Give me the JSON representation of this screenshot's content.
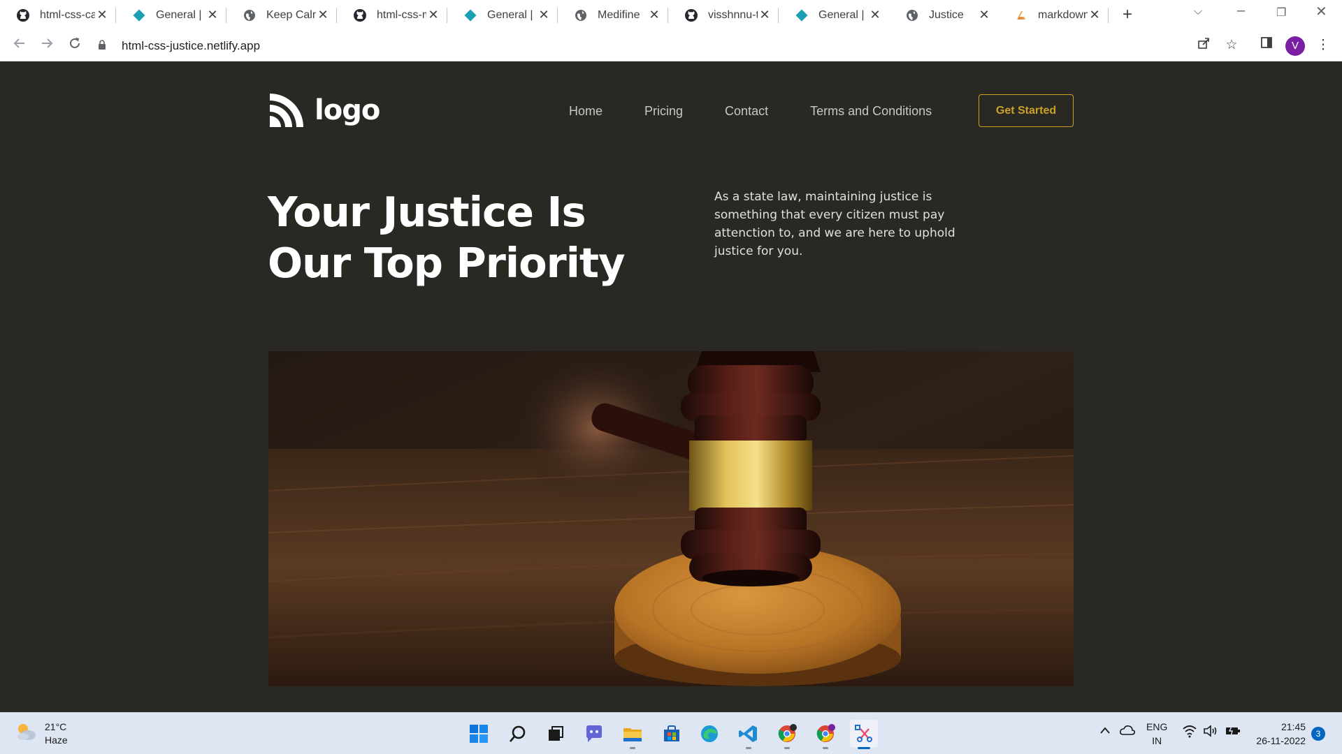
{
  "browser": {
    "tabs": [
      {
        "title": "html-css-ca",
        "icon": "github-icon"
      },
      {
        "title": "General | Si",
        "icon": "diamond-icon"
      },
      {
        "title": "Keep Calm",
        "icon": "globe-icon"
      },
      {
        "title": "html-css-m",
        "icon": "github-icon"
      },
      {
        "title": "General | Si",
        "icon": "diamond-icon"
      },
      {
        "title": "Medifine",
        "icon": "globe-icon"
      },
      {
        "title": "visshnnu-te",
        "icon": "github-icon"
      },
      {
        "title": "General | Si",
        "icon": "diamond-icon"
      },
      {
        "title": "Justice",
        "icon": "globe-icon",
        "active": true
      },
      {
        "title": "markdown",
        "icon": "markdown-icon"
      }
    ],
    "url": "html-css-justice.netlify.app",
    "profile_initial": "V"
  },
  "site": {
    "logo_text": "logo",
    "nav": [
      "Home",
      "Pricing",
      "Contact",
      "Terms and Conditions"
    ],
    "cta_label": "Get Started",
    "hero_title_line1": "Your Justice Is",
    "hero_title_line2": "Our Top Priority",
    "hero_text": "As a state law, maintaining justice is something that every citizen must pay attenction to, and we are here to uphold justice for you.",
    "hero_image": "gavel-on-sound-block-photo"
  },
  "taskbar": {
    "temperature": "21°C",
    "condition": "Haze",
    "language_line1": "ENG",
    "language_line2": "IN",
    "time": "21:45",
    "date": "26-11-2022",
    "notifications": "3",
    "apps": [
      "windows-start-icon",
      "search-icon",
      "task-view-icon",
      "chat-icon",
      "file-explorer-icon",
      "store-icon",
      "edge-icon",
      "vscode-icon",
      "chrome-icon",
      "chrome-profile-icon",
      "snipping-tool-icon"
    ]
  },
  "colors": {
    "page_bg": "#2a2823",
    "accent_gold": "#c9a227",
    "text_white": "#ffffff"
  }
}
